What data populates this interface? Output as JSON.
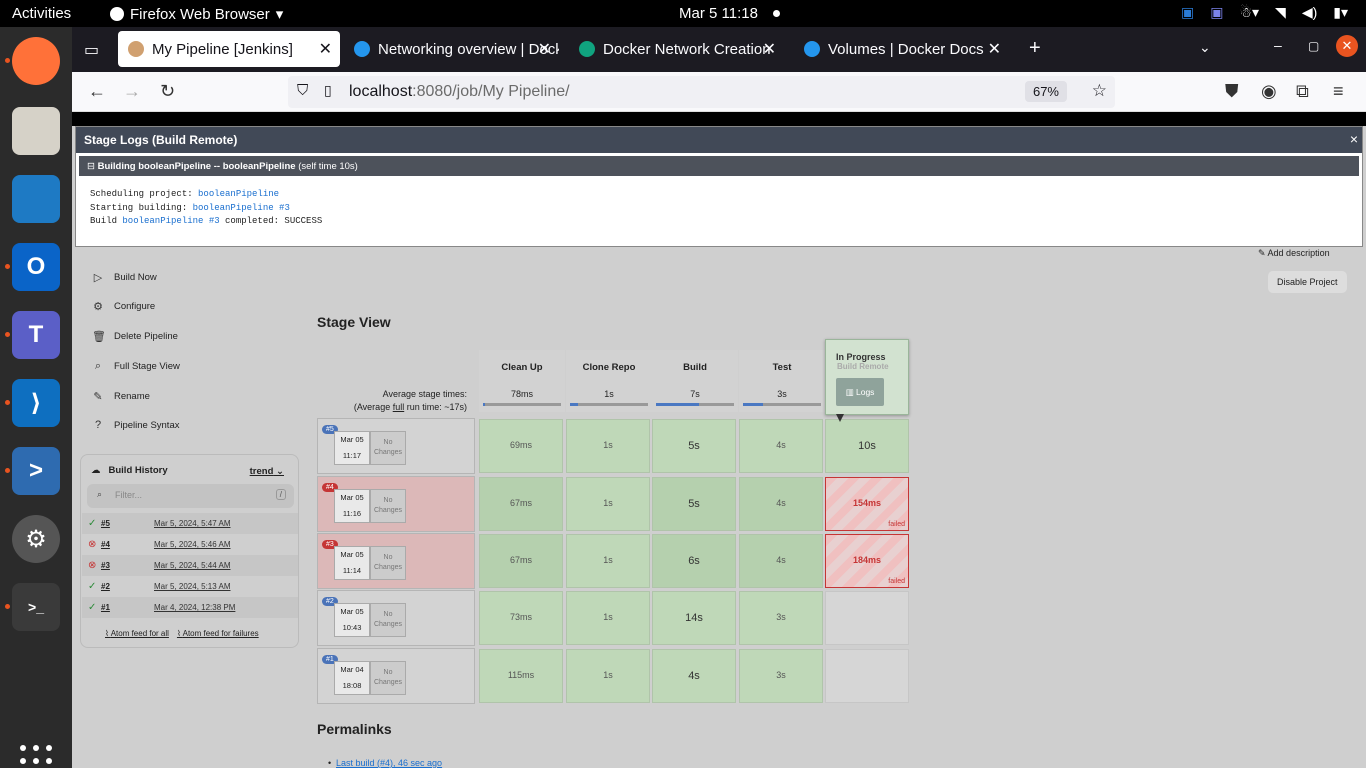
{
  "topbar": {
    "activities": "Activities",
    "app": "Firefox Web Browser",
    "clock": "Mar 5  11:18"
  },
  "tabs": [
    {
      "title": "My Pipeline [Jenkins]",
      "active": true
    },
    {
      "title": "Networking overview | Docker"
    },
    {
      "title": "Docker Network Creation"
    },
    {
      "title": "Volumes | Docker Docs"
    }
  ],
  "url": {
    "host": "localhost",
    "path": ":8080/job/My Pipeline/",
    "zoom": "67%"
  },
  "stagelog": {
    "title": "Stage Logs (Build Remote)",
    "close": "×",
    "sub": "Building booleanPipeline -- booleanPipeline",
    "sub_time": "(self time 10s)",
    "l1_pre": "Scheduling project: ",
    "l1_link": "booleanPipeline",
    "l2_pre": "Starting building: ",
    "l2_link": "booleanPipeline #3",
    "l3_pre": "Build ",
    "l3_link": "booleanPipeline #3",
    "l3_post": " completed: SUCCESS"
  },
  "sidebar": [
    {
      "label": "Build Now",
      "icon": "▷"
    },
    {
      "label": "Configure",
      "icon": "⚙"
    },
    {
      "label": "Delete Pipeline",
      "icon": "🗑"
    },
    {
      "label": "Full Stage View",
      "icon": "⌕"
    },
    {
      "label": "Rename",
      "icon": "✎"
    },
    {
      "label": "Pipeline Syntax",
      "icon": "?"
    }
  ],
  "build_history": {
    "title": "Build History",
    "trend": "trend",
    "filter": "Filter...",
    "slash": "/",
    "rows": [
      {
        "num": "#5",
        "date": "Mar 5, 2024, 5:47 AM",
        "status": "ok"
      },
      {
        "num": "#4",
        "date": "Mar 5, 2024, 5:46 AM",
        "status": "fail"
      },
      {
        "num": "#3",
        "date": "Mar 5, 2024, 5:44 AM",
        "status": "fail"
      },
      {
        "num": "#2",
        "date": "Mar 5, 2024, 5:13 AM",
        "status": "ok"
      },
      {
        "num": "#1",
        "date": "Mar 4, 2024, 12:38 PM",
        "status": "ok"
      }
    ],
    "feed_all": "Atom feed for all",
    "feed_fail": "Atom feed for failures"
  },
  "actions": {
    "add_description": "Add description",
    "disable": "Disable Project"
  },
  "stage_view": {
    "title": "Stage View",
    "avg_label_1": "Average stage times:",
    "avg_label_2": "(Average ",
    "avg_full": "full",
    "avg_label_3": " run time: ~17s)",
    "columns": [
      {
        "name": "Clean Up",
        "avg": "78ms",
        "fill": 0.02
      },
      {
        "name": "Clone Repo",
        "avg": "1s",
        "fill": 0.1
      },
      {
        "name": "Build",
        "avg": "7s",
        "fill": 0.55
      },
      {
        "name": "Test",
        "avg": "3s",
        "fill": 0.25
      },
      {
        "name": "Build Remote",
        "avg": "",
        "fill": 0
      }
    ],
    "in_progress": "In Progress",
    "in_progress_stage": "Build Remote",
    "logs_btn": "Logs",
    "no_changes": "No Changes",
    "failed": "failed",
    "runs": [
      {
        "badge": "#5",
        "date": "Mar 05",
        "time": "11:17",
        "fail": false,
        "cells": [
          "69ms",
          "1s",
          "5s",
          "4s",
          "10s"
        ]
      },
      {
        "badge": "#4",
        "date": "Mar 05",
        "time": "11:16",
        "fail": true,
        "cells": [
          "67ms",
          "1s",
          "5s",
          "4s",
          "154ms"
        ]
      },
      {
        "badge": "#3",
        "date": "Mar 05",
        "time": "11:14",
        "fail": true,
        "cells": [
          "67ms",
          "1s",
          "6s",
          "4s",
          "184ms"
        ]
      },
      {
        "badge": "#2",
        "date": "Mar 05",
        "time": "10:43",
        "fail": false,
        "cells": [
          "73ms",
          "1s",
          "14s",
          "3s",
          ""
        ]
      },
      {
        "badge": "#1",
        "date": "Mar 04",
        "time": "18:08",
        "fail": false,
        "cells": [
          "115ms",
          "1s",
          "4s",
          "3s",
          ""
        ]
      }
    ]
  },
  "permalinks": {
    "title": "Permalinks",
    "first": "Last build (#4), 46 sec ago"
  }
}
